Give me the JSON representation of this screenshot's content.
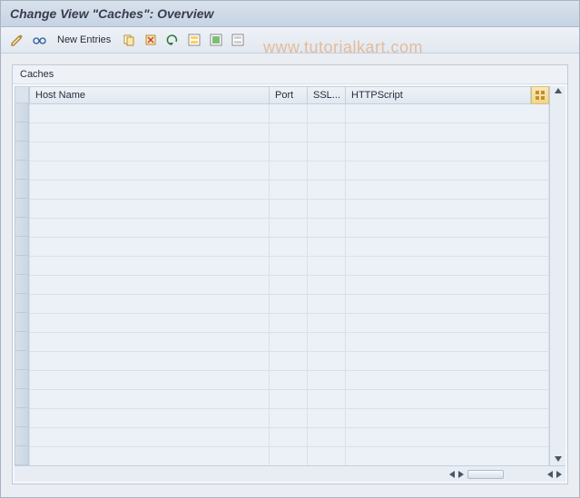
{
  "titlebar": {
    "text": "Change View \"Caches\": Overview"
  },
  "toolbar": {
    "new_entries_label": "New Entries",
    "icons": {
      "change": "change-icon",
      "other_view": "glasses-icon",
      "copy": "copy-icon",
      "delete": "delete-icon",
      "undo": "undo-icon",
      "select_all": "select-all-icon",
      "select_block": "select-block-icon",
      "deselect": "deselect-icon"
    }
  },
  "group": {
    "title": "Caches"
  },
  "table": {
    "columns": {
      "host": "Host Name",
      "port": "Port",
      "ssl": "SSL...",
      "script": "HTTPScript"
    },
    "rows": [
      {
        "host": "",
        "port": "",
        "ssl": "",
        "script": ""
      },
      {
        "host": "",
        "port": "",
        "ssl": "",
        "script": ""
      },
      {
        "host": "",
        "port": "",
        "ssl": "",
        "script": ""
      },
      {
        "host": "",
        "port": "",
        "ssl": "",
        "script": ""
      },
      {
        "host": "",
        "port": "",
        "ssl": "",
        "script": ""
      },
      {
        "host": "",
        "port": "",
        "ssl": "",
        "script": ""
      },
      {
        "host": "",
        "port": "",
        "ssl": "",
        "script": ""
      },
      {
        "host": "",
        "port": "",
        "ssl": "",
        "script": ""
      },
      {
        "host": "",
        "port": "",
        "ssl": "",
        "script": ""
      },
      {
        "host": "",
        "port": "",
        "ssl": "",
        "script": ""
      },
      {
        "host": "",
        "port": "",
        "ssl": "",
        "script": ""
      },
      {
        "host": "",
        "port": "",
        "ssl": "",
        "script": ""
      },
      {
        "host": "",
        "port": "",
        "ssl": "",
        "script": ""
      },
      {
        "host": "",
        "port": "",
        "ssl": "",
        "script": ""
      },
      {
        "host": "",
        "port": "",
        "ssl": "",
        "script": ""
      },
      {
        "host": "",
        "port": "",
        "ssl": "",
        "script": ""
      },
      {
        "host": "",
        "port": "",
        "ssl": "",
        "script": ""
      },
      {
        "host": "",
        "port": "",
        "ssl": "",
        "script": ""
      },
      {
        "host": "",
        "port": "",
        "ssl": "",
        "script": ""
      }
    ]
  },
  "watermark": "www.tutorialkart.com"
}
